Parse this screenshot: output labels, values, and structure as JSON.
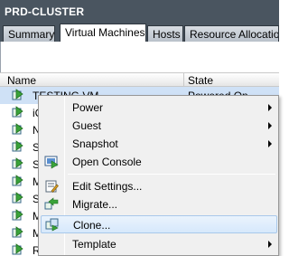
{
  "window": {
    "title": "PRD-CLUSTER"
  },
  "tabs": [
    {
      "label": "Summary"
    },
    {
      "label": "Virtual Machines",
      "active": true
    },
    {
      "label": "Hosts"
    },
    {
      "label": "Resource Allocation"
    }
  ],
  "table": {
    "columns": [
      "Name",
      "State"
    ],
    "rows": [
      {
        "name": "TESTING VM",
        "state": "Powered On",
        "selected": true
      },
      {
        "name": "iC",
        "state": ""
      },
      {
        "name": "N",
        "state": ""
      },
      {
        "name": "S",
        "state": ""
      },
      {
        "name": "S",
        "state": ""
      },
      {
        "name": "M",
        "state": ""
      },
      {
        "name": "S",
        "state": ""
      },
      {
        "name": "M",
        "state": ""
      },
      {
        "name": "M",
        "state": ""
      },
      {
        "name": "R",
        "state": ""
      }
    ]
  },
  "context_menu": {
    "items": [
      {
        "label": "Power",
        "submenu": true
      },
      {
        "label": "Guest",
        "submenu": true
      },
      {
        "label": "Snapshot",
        "submenu": true
      },
      {
        "label": "Open Console",
        "icon": "console-icon"
      },
      {
        "label": "Edit Settings...",
        "icon": "edit-settings-icon"
      },
      {
        "label": "Migrate...",
        "icon": "migrate-icon"
      },
      {
        "label": "Clone...",
        "icon": "clone-icon",
        "highlighted": true
      },
      {
        "label": "Template",
        "submenu": true
      }
    ]
  },
  "colors": {
    "titlebar": "#4a5560",
    "selection": "#cfe1f6",
    "menu_hover": "#d6e8fb",
    "vm_icon": "#3aa33a"
  }
}
